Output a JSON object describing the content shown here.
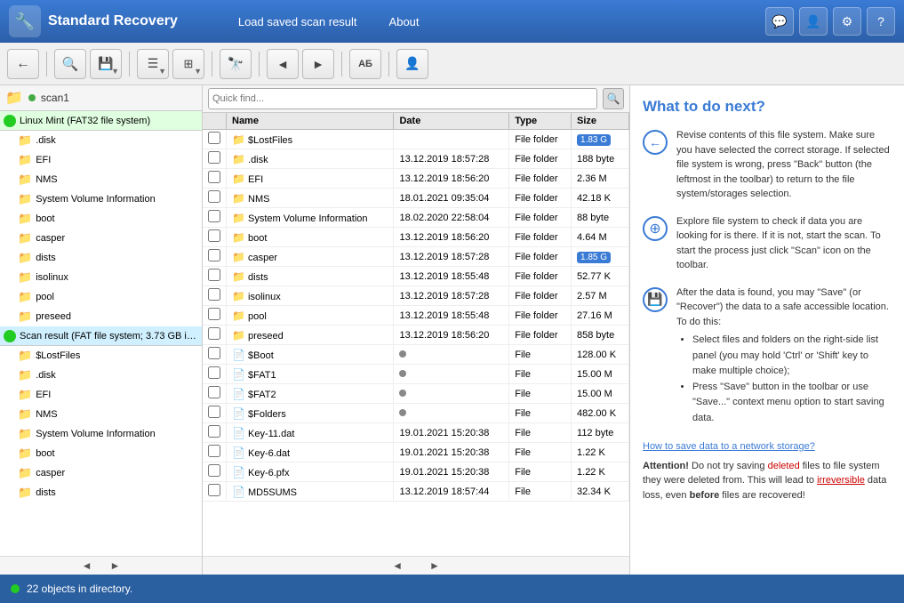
{
  "header": {
    "logo_icon": "🔧",
    "title": "Standard Recovery",
    "nav": [
      {
        "label": "Load saved scan result",
        "id": "load-scan"
      },
      {
        "label": "About",
        "id": "about"
      }
    ],
    "icons": [
      "💬",
      "👤",
      "⚙",
      "?"
    ]
  },
  "toolbar": {
    "buttons": [
      {
        "id": "back",
        "icon": "←",
        "has_dropdown": false
      },
      {
        "id": "scan",
        "icon": "🔍",
        "has_dropdown": false
      },
      {
        "id": "save",
        "icon": "💾",
        "has_dropdown": true
      },
      {
        "id": "list",
        "icon": "☰",
        "has_dropdown": true
      },
      {
        "id": "view",
        "icon": "⊞",
        "has_dropdown": true
      },
      {
        "id": "preview",
        "icon": "🔭",
        "has_dropdown": false
      },
      {
        "id": "prev",
        "icon": "◄",
        "has_dropdown": false
      },
      {
        "id": "next",
        "icon": "►",
        "has_dropdown": false
      },
      {
        "id": "rename",
        "icon": "АБ",
        "has_dropdown": false
      },
      {
        "id": "info",
        "icon": "👤",
        "has_dropdown": false
      }
    ]
  },
  "left_panel": {
    "path": "scan1",
    "tree": [
      {
        "label": "Linux Mint (FAT32 file system)",
        "level": 0,
        "type": "drive",
        "has_dot": true,
        "dot_color": "#22cc22"
      },
      {
        "label": ".disk",
        "level": 1,
        "type": "folder"
      },
      {
        "label": "EFI",
        "level": 1,
        "type": "folder"
      },
      {
        "label": "NMS",
        "level": 1,
        "type": "folder"
      },
      {
        "label": "System Volume Information",
        "level": 1,
        "type": "folder"
      },
      {
        "label": "boot",
        "level": 1,
        "type": "folder"
      },
      {
        "label": "casper",
        "level": 1,
        "type": "folder"
      },
      {
        "label": "dists",
        "level": 1,
        "type": "folder"
      },
      {
        "label": "isolinux",
        "level": 1,
        "type": "folder"
      },
      {
        "label": "pool",
        "level": 1,
        "type": "folder"
      },
      {
        "label": "preseed",
        "level": 1,
        "type": "folder"
      },
      {
        "label": "Scan result (FAT file system; 3.73 GB in...",
        "level": 0,
        "type": "drive",
        "has_dot": true,
        "dot_color": "#22cc22"
      },
      {
        "label": "$LostFiles",
        "level": 1,
        "type": "folder"
      },
      {
        "label": ".disk",
        "level": 1,
        "type": "folder"
      },
      {
        "label": "EFI",
        "level": 1,
        "type": "folder"
      },
      {
        "label": "NMS",
        "level": 1,
        "type": "folder"
      },
      {
        "label": "System Volume Information",
        "level": 1,
        "type": "folder"
      },
      {
        "label": "boot",
        "level": 1,
        "type": "folder"
      },
      {
        "label": "casper",
        "level": 1,
        "type": "folder"
      },
      {
        "label": "dists",
        "level": 1,
        "type": "folder"
      }
    ]
  },
  "search": {
    "placeholder": "Quick find..."
  },
  "file_table": {
    "columns": [
      "Name",
      "Date",
      "Type",
      "Size"
    ],
    "rows": [
      {
        "name": "$LostFiles",
        "date": "",
        "type": "File folder",
        "size": "1.83 G",
        "is_folder": true,
        "has_checkbox": true,
        "size_badge": true
      },
      {
        "name": ".disk",
        "date": "13.12.2019 18:57:28",
        "type": "File folder",
        "size": "188 byte",
        "is_folder": true,
        "has_checkbox": true
      },
      {
        "name": "EFI",
        "date": "13.12.2019 18:56:20",
        "type": "File folder",
        "size": "2.36 M",
        "is_folder": true,
        "has_checkbox": true
      },
      {
        "name": "NMS",
        "date": "18.01.2021 09:35:04",
        "type": "File folder",
        "size": "42.18 K",
        "is_folder": true,
        "has_checkbox": true
      },
      {
        "name": "System Volume Information",
        "date": "18.02.2020 22:58:04",
        "type": "File folder",
        "size": "88 byte",
        "is_folder": true,
        "has_checkbox": true
      },
      {
        "name": "boot",
        "date": "13.12.2019 18:56:20",
        "type": "File folder",
        "size": "4.64 M",
        "is_folder": true,
        "has_checkbox": true
      },
      {
        "name": "casper",
        "date": "13.12.2019 18:57:28",
        "type": "File folder",
        "size": "1.85 G",
        "is_folder": true,
        "has_checkbox": true,
        "size_badge": true
      },
      {
        "name": "dists",
        "date": "13.12.2019 18:55:48",
        "type": "File folder",
        "size": "52.77 K",
        "is_folder": true,
        "has_checkbox": true
      },
      {
        "name": "isolinux",
        "date": "13.12.2019 18:57:28",
        "type": "File folder",
        "size": "2.57 M",
        "is_folder": true,
        "has_checkbox": true
      },
      {
        "name": "pool",
        "date": "13.12.2019 18:55:48",
        "type": "File folder",
        "size": "27.16 M",
        "is_folder": true,
        "has_checkbox": true
      },
      {
        "name": "preseed",
        "date": "13.12.2019 18:56:20",
        "type": "File folder",
        "size": "858 byte",
        "is_folder": true,
        "has_checkbox": true
      },
      {
        "name": "$Boot",
        "date": "",
        "type": "File",
        "size": "128.00 K",
        "is_folder": false,
        "has_checkbox": true
      },
      {
        "name": "$FAT1",
        "date": "",
        "type": "File",
        "size": "15.00 M",
        "is_folder": false,
        "has_checkbox": true
      },
      {
        "name": "$FAT2",
        "date": "",
        "type": "File",
        "size": "15.00 M",
        "is_folder": false,
        "has_checkbox": true
      },
      {
        "name": "$Folders",
        "date": "",
        "type": "File",
        "size": "482.00 K",
        "is_folder": false,
        "has_checkbox": true
      },
      {
        "name": "Key-11.dat",
        "date": "19.01.2021 15:20:38",
        "type": "File",
        "size": "112 byte",
        "is_folder": false,
        "has_checkbox": true
      },
      {
        "name": "Key-6.dat",
        "date": "19.01.2021 15:20:38",
        "type": "File",
        "size": "1.22 K",
        "is_folder": false,
        "has_checkbox": true
      },
      {
        "name": "Key-6.pfx",
        "date": "19.01.2021 15:20:38",
        "type": "File",
        "size": "1.22 K",
        "is_folder": false,
        "has_checkbox": true
      },
      {
        "name": "MD5SUMS",
        "date": "13.12.2019 18:57:44",
        "type": "File",
        "size": "32.34 K",
        "is_folder": false,
        "has_checkbox": true
      }
    ]
  },
  "info_panel": {
    "title": "What to do next?",
    "sections": [
      {
        "icon": "←",
        "text": "Revise contents of this file system. Make sure you have selected the correct storage. If selected file system is wrong, press \"Back\" button (the leftmost in the toolbar) to return to the file system/storages selection."
      },
      {
        "icon": "⊕",
        "text": "Explore file system to check if data you are looking for is there. If it is not, start the scan. To start the process just click \"Scan\" icon on the toolbar."
      },
      {
        "icon": "💾",
        "text": "After the data is found, you may \"Save\" (or \"Recover\") the data to a safe accessible location. To do this:",
        "bullets": [
          "Select files and folders on the right-side list panel (you may hold 'Ctrl' or 'Shift' key to make multiple choice);",
          "Press \"Save\" button in the toolbar or use \"Save...\" context menu option to start saving data."
        ]
      }
    ],
    "link": "How to save data to a network storage?",
    "attention": {
      "prefix": "Attention!",
      "text1": " Do not try saving ",
      "deleted": "deleted",
      "text2": " files to file system they were deleted from. This will lead to ",
      "irrev": "irreversible",
      "text3": " data loss, even ",
      "before": "before",
      "text4": " files are recovered!"
    }
  },
  "status_bar": {
    "count_label": "22 objects in directory."
  }
}
